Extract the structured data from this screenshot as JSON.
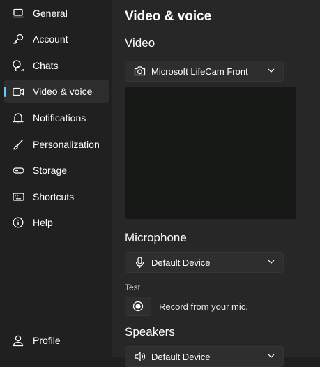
{
  "sidebar": {
    "items": [
      {
        "label": "General",
        "icon": "laptop-icon"
      },
      {
        "label": "Account",
        "icon": "key-icon"
      },
      {
        "label": "Chats",
        "icon": "chat-bubbles-icon"
      },
      {
        "label": "Video & voice",
        "icon": "video-camera-icon",
        "active": true
      },
      {
        "label": "Notifications",
        "icon": "bell-icon"
      },
      {
        "label": "Personalization",
        "icon": "brush-icon"
      },
      {
        "label": "Storage",
        "icon": "storage-icon"
      },
      {
        "label": "Shortcuts",
        "icon": "keyboard-icon"
      },
      {
        "label": "Help",
        "icon": "info-icon"
      }
    ],
    "profile": {
      "label": "Profile",
      "icon": "person-icon"
    }
  },
  "main": {
    "title": "Video & voice",
    "video": {
      "title": "Video",
      "camera": "Microsoft LifeCam Front"
    },
    "microphone": {
      "title": "Microphone",
      "device": "Default Device"
    },
    "test": {
      "label": "Test",
      "record_text": "Record from your mic."
    },
    "speakers": {
      "title": "Speakers",
      "device": "Default Device"
    }
  },
  "colors": {
    "accent": "#60cdff",
    "background": "#272727",
    "sidebar": "#202020"
  }
}
